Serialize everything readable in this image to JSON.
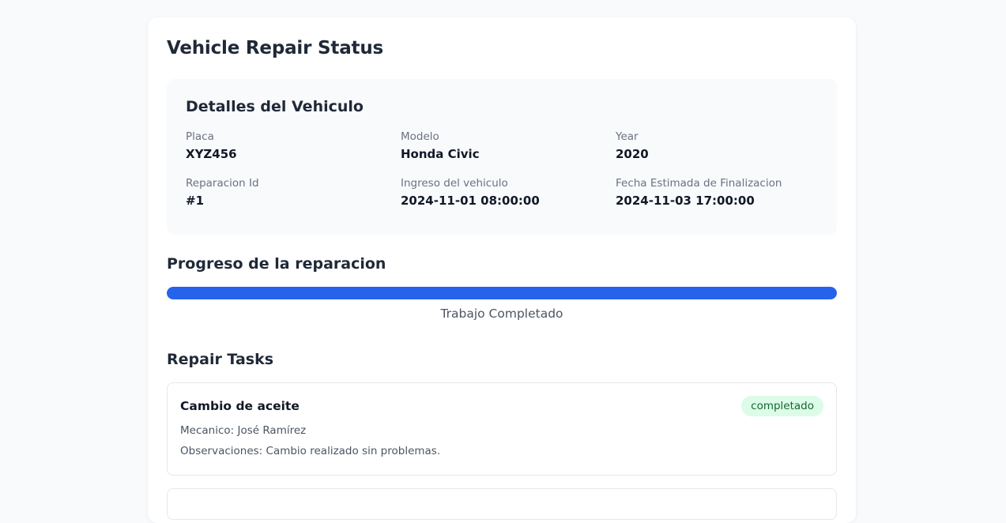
{
  "page": {
    "title": "Vehicle Repair Status"
  },
  "vehicle": {
    "section_title": "Detalles del Vehiculo",
    "fields": [
      {
        "label": "Placa",
        "value": "XYZ456"
      },
      {
        "label": "Modelo",
        "value": "Honda Civic"
      },
      {
        "label": "Year",
        "value": "2020"
      },
      {
        "label": "Reparacion Id",
        "value": "#1"
      },
      {
        "label": "Ingreso del vehiculo",
        "value": "2024-11-01 08:00:00"
      },
      {
        "label": "Fecha Estimada de Finalizacion",
        "value": "2024-11-03 17:00:00"
      }
    ]
  },
  "progress": {
    "section_title": "Progreso de la reparacion",
    "percent": 100,
    "status_text": "Trabajo Completado",
    "color": "#2563eb"
  },
  "tasks": {
    "section_title": "Repair Tasks",
    "items": [
      {
        "name": "Cambio de aceite",
        "status": "completado",
        "mechanic": "Mecanico: José Ramírez",
        "notes": "Observaciones: Cambio realizado sin problemas."
      }
    ]
  }
}
